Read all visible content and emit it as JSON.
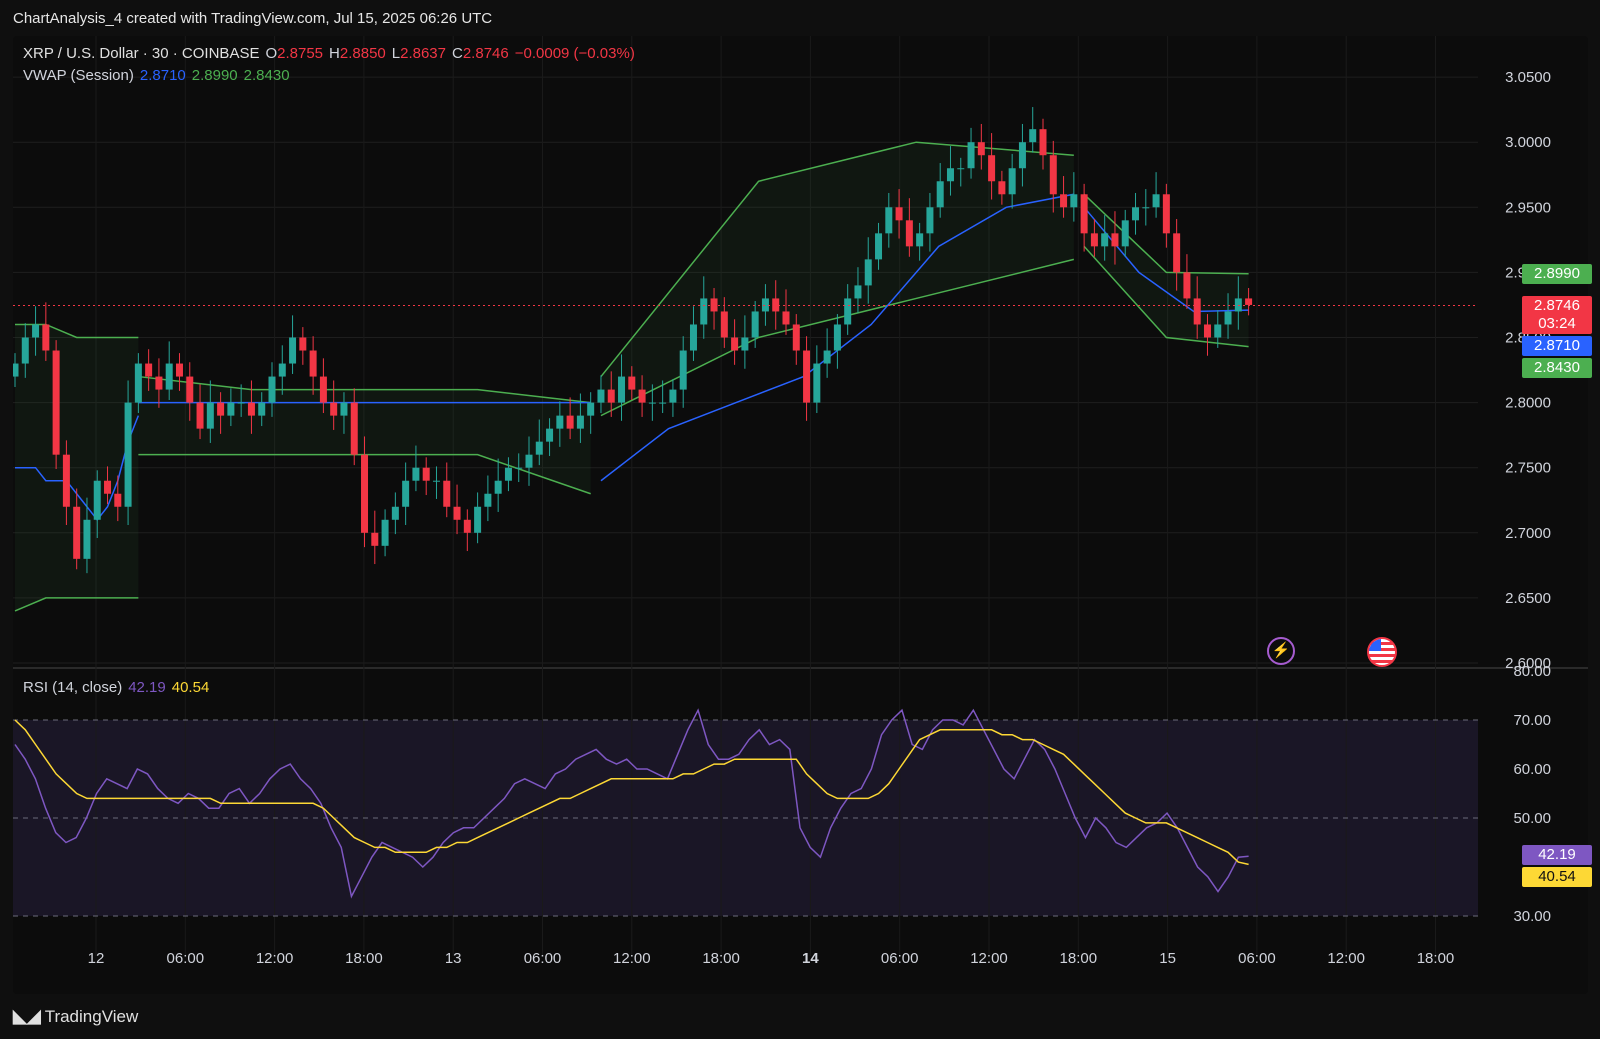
{
  "caption": "ChartAnalysis_4 created with TradingView.com, Jul 15, 2025 06:26 UTC",
  "legend": {
    "symbol": "XRP / U.S. Dollar · 30 · COINBASE",
    "o_label": "O",
    "o_val": "2.8755",
    "h_label": "H",
    "h_val": "2.8850",
    "l_label": "L",
    "l_val": "2.8637",
    "c_label": "C",
    "c_val": "2.8746",
    "change": "−0.0009 (−0.03%)",
    "vwap_label": "VWAP (Session)",
    "vwap_vals": [
      "2.8710",
      "2.8990",
      "2.8430"
    ],
    "rsi_label": "RSI (14, close)",
    "rsi_vals": [
      "42.19",
      "40.54"
    ]
  },
  "price_tags": {
    "upper": "2.8990",
    "last": "2.8746",
    "countdown": "03:24",
    "vwap": "2.8710",
    "lower": "2.8430",
    "rsi": "42.19",
    "rsi_ma": "40.54"
  },
  "brand": "TradingView",
  "colors": {
    "up": "#26a69a",
    "down": "#f23645",
    "vwap": "#2962ff",
    "band": "#4caf50",
    "rsi": "#7e57c2",
    "rsi_ma": "#fdd835",
    "text": "#d1d4dc"
  },
  "chart_data": [
    {
      "type": "candlestick",
      "title": "XRP / U.S. Dollar · 30 · COINBASE",
      "x_tick_labels": [
        "12",
        "06:00",
        "12:00",
        "18:00",
        "13",
        "06:00",
        "12:00",
        "18:00",
        "14",
        "06:00",
        "12:00",
        "18:00",
        "15",
        "06:00",
        "12:00",
        "18:00"
      ],
      "y_tick_labels": [
        "3.0500",
        "3.0000",
        "2.9500",
        "2.9000",
        "2.8500",
        "2.8000",
        "2.7500",
        "2.7000",
        "2.6500",
        "2.6000"
      ],
      "ylim": [
        2.6,
        3.07
      ],
      "grid": true,
      "price_close": [
        2.83,
        2.85,
        2.86,
        2.84,
        2.76,
        2.72,
        2.68,
        2.71,
        2.74,
        2.73,
        2.72,
        2.8,
        2.83,
        2.82,
        2.81,
        2.83,
        2.82,
        2.8,
        2.78,
        2.8,
        2.79,
        2.8,
        2.8,
        2.79,
        2.8,
        2.82,
        2.83,
        2.85,
        2.84,
        2.82,
        2.8,
        2.79,
        2.8,
        2.76,
        2.7,
        2.69,
        2.71,
        2.72,
        2.74,
        2.75,
        2.74,
        2.74,
        2.72,
        2.71,
        2.7,
        2.72,
        2.73,
        2.74,
        2.75,
        2.75,
        2.76,
        2.77,
        2.78,
        2.79,
        2.78,
        2.79,
        2.8,
        2.81,
        2.8,
        2.82,
        2.81,
        2.8,
        2.8,
        2.8,
        2.81,
        2.84,
        2.86,
        2.88,
        2.87,
        2.85,
        2.84,
        2.85,
        2.87,
        2.88,
        2.87,
        2.86,
        2.84,
        2.8,
        2.83,
        2.84,
        2.86,
        2.88,
        2.89,
        2.91,
        2.93,
        2.95,
        2.94,
        2.92,
        2.93,
        2.95,
        2.97,
        2.98,
        2.98,
        3.0,
        2.99,
        2.97,
        2.96,
        2.98,
        3.0,
        3.01,
        2.99,
        2.96,
        2.95,
        2.96,
        2.93,
        2.92,
        2.93,
        2.92,
        2.94,
        2.95,
        2.95,
        2.96,
        2.93,
        2.9,
        2.88,
        2.86,
        2.85,
        2.86,
        2.87,
        2.88,
        2.875
      ],
      "vwap_session": [
        {
          "from_index": 0,
          "to_index": 12,
          "vwap": [
            2.75,
            2.75,
            2.75,
            2.74,
            2.74,
            2.74,
            2.73,
            2.72,
            2.71,
            2.72,
            2.74,
            2.77,
            2.79
          ],
          "upper": [
            2.86,
            2.86,
            2.85,
            2.85,
            2.85
          ],
          "lower": [
            2.64,
            2.65,
            2.65,
            2.65,
            2.65
          ]
        },
        {
          "from_index": 12,
          "to_index": 56,
          "vwap": 2.8,
          "upper": [
            2.82,
            2.81,
            2.81,
            2.81,
            2.8
          ],
          "lower": [
            2.76,
            2.76,
            2.76,
            2.76,
            2.73
          ]
        },
        {
          "from_index": 57,
          "to_index": 103,
          "vwap": [
            2.74,
            2.78,
            2.8,
            2.82,
            2.86,
            2.92,
            2.95,
            2.96
          ],
          "upper": [
            2.82,
            2.97,
            3.0,
            2.99
          ],
          "lower": [
            2.79,
            2.85,
            2.88,
            2.91
          ]
        },
        {
          "from_index": 104,
          "to_index": 120,
          "vwap": [
            2.95,
            2.9,
            2.87,
            2.871
          ],
          "upper": [
            2.96,
            2.9,
            2.899
          ],
          "lower": [
            2.92,
            2.85,
            2.843
          ]
        }
      ]
    },
    {
      "type": "line",
      "title": "RSI (14, close)",
      "y_tick_labels": [
        "80.00",
        "70.00",
        "60.00",
        "50.00",
        "30.00"
      ],
      "ylim": [
        30,
        80
      ],
      "bands": [
        70,
        50,
        30
      ],
      "series": [
        {
          "name": "RSI",
          "values": [
            65,
            62,
            58,
            52,
            47,
            45,
            46,
            50,
            55,
            58,
            57,
            56,
            60,
            59,
            56,
            54,
            53,
            55,
            54,
            52,
            52,
            55,
            56,
            53,
            55,
            58,
            60,
            61,
            58,
            56,
            53,
            48,
            44,
            34,
            38,
            42,
            45,
            44,
            43,
            42,
            40,
            42,
            45,
            47,
            48,
            48,
            50,
            52,
            54,
            57,
            58,
            57,
            56,
            59,
            60,
            62,
            63,
            64,
            62,
            61,
            62,
            60,
            60,
            59,
            58,
            63,
            68,
            72,
            65,
            62,
            62,
            63,
            66,
            68,
            65,
            66,
            64,
            48,
            44,
            42,
            48,
            52,
            55,
            56,
            60,
            67,
            70,
            72,
            65,
            64,
            68,
            70,
            70,
            69,
            72,
            68,
            64,
            60,
            58,
            62,
            66,
            64,
            60,
            55,
            50,
            46,
            50,
            48,
            45,
            44,
            46,
            48,
            49,
            51,
            48,
            44,
            40,
            38,
            35,
            38,
            42,
            42.19
          ]
        },
        {
          "name": "RSI-based MA",
          "values": [
            70,
            68,
            65,
            62,
            59,
            57,
            55,
            54,
            54,
            54,
            54,
            54,
            54,
            54,
            54,
            54,
            54,
            54,
            54,
            54,
            53,
            53,
            53,
            53,
            53,
            53,
            53,
            53,
            53,
            53,
            52,
            50,
            48,
            46,
            45,
            44,
            44,
            43,
            43,
            43,
            43,
            44,
            44,
            45,
            45,
            46,
            47,
            48,
            49,
            50,
            51,
            52,
            53,
            54,
            54,
            55,
            56,
            57,
            58,
            58,
            58,
            58,
            58,
            58,
            58,
            59,
            59,
            60,
            61,
            61,
            62,
            62,
            62,
            62,
            62,
            62,
            62,
            59,
            57,
            55,
            54,
            54,
            54,
            54,
            55,
            57,
            60,
            63,
            66,
            67,
            68,
            68,
            68,
            68,
            68,
            68,
            67,
            67,
            66,
            66,
            65,
            64,
            63,
            61,
            59,
            57,
            55,
            53,
            51,
            50,
            49,
            49,
            49,
            48,
            47,
            46,
            45,
            44,
            43,
            41,
            40.54
          ]
        }
      ]
    }
  ]
}
